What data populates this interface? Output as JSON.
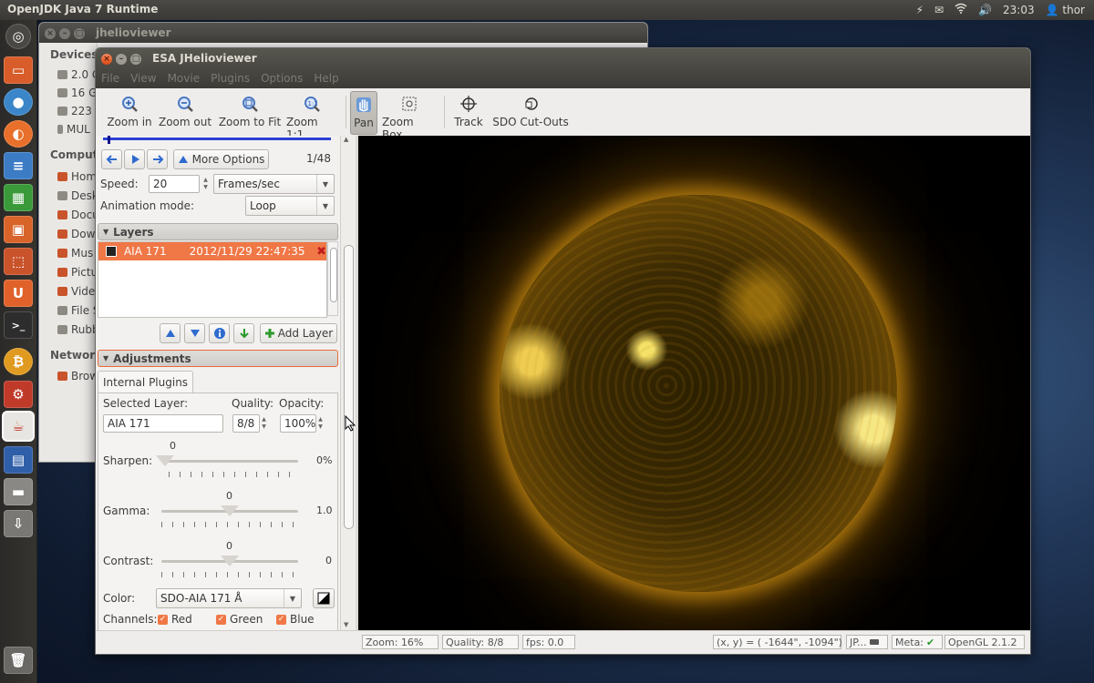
{
  "top_panel": {
    "app_title": "OpenJDK Java 7 Runtime",
    "clock": "23:03",
    "user": "thor"
  },
  "launcher": {
    "items": [
      "dash",
      "files",
      "chromium",
      "firefox",
      "writer",
      "calc",
      "impress",
      "software-center",
      "ubuntu-one",
      "terminal",
      "bitcoin",
      "settings",
      "java",
      "workspaces",
      "disk",
      "usb",
      "trash"
    ]
  },
  "bg_window": {
    "title": "jhelioviewer",
    "devices_header": "Devices",
    "devices": [
      "2.0 G",
      "16 G",
      "223 G",
      "MUL"
    ],
    "computer_header": "Comput",
    "computer_items": [
      "Hom",
      "Desk",
      "Docu",
      "Dow",
      "Mus",
      "Pictu",
      "Vide",
      "File S",
      "Rubb"
    ],
    "network_header": "Networ",
    "network_items": [
      "Brow"
    ]
  },
  "main_window": {
    "title": "ESA JHelioviewer",
    "menu": [
      "File",
      "View",
      "Movie",
      "Plugins",
      "Options",
      "Help"
    ]
  },
  "toolbar": {
    "buttons": [
      {
        "label": "Zoom in"
      },
      {
        "label": "Zoom out"
      },
      {
        "label": "Zoom to Fit"
      },
      {
        "label": "Zoom 1:1"
      },
      {
        "label": "Pan"
      },
      {
        "label": "Zoom Box"
      },
      {
        "label": "Track"
      },
      {
        "label": "SDO Cut-Outs"
      }
    ]
  },
  "movie": {
    "more_options": "More Options",
    "frame_counter": "1/48",
    "speed_label": "Speed:",
    "speed_value": "20",
    "speed_unit": "Frames/sec",
    "animation_label": "Animation mode:",
    "animation_value": "Loop",
    "progress": 0.02
  },
  "layers": {
    "header": "Layers",
    "items": [
      {
        "name": "AIA 171",
        "date": "2012/11/29 22:47:35"
      }
    ],
    "add_layer": "Add Layer"
  },
  "adjustments": {
    "header": "Adjustments",
    "tab": "Internal Plugins",
    "selected_layer_label": "Selected Layer:",
    "selected_layer_value": "AIA 171",
    "quality_label": "Quality:",
    "quality_value": "8/8",
    "opacity_label": "Opacity:",
    "opacity_value": "100%",
    "sharpen": {
      "label": "Sharpen:",
      "top": "0",
      "value": "0%",
      "position": 0.0
    },
    "gamma": {
      "label": "Gamma:",
      "top": "0",
      "value": "1.0",
      "position": 0.5
    },
    "contrast": {
      "label": "Contrast:",
      "top": "0",
      "value": "0",
      "position": 0.5
    },
    "color_label": "Color:",
    "color_value": "SDO-AIA 171 Å",
    "channels_label": "Channels:",
    "channels": [
      "Red",
      "Green",
      "Blue"
    ]
  },
  "status": {
    "zoom": "Zoom: 16%",
    "quality": "Quality: 8/8",
    "fps": "fps: 0.0",
    "coords": "(x, y) = ( -1644\", -1094\")",
    "format": "JP...",
    "meta": "Meta:",
    "opengl": "OpenGL 2.1.2"
  },
  "colors": {
    "accent": "#f07746",
    "sun": "#d69614",
    "progress": "#2b3fd6"
  }
}
